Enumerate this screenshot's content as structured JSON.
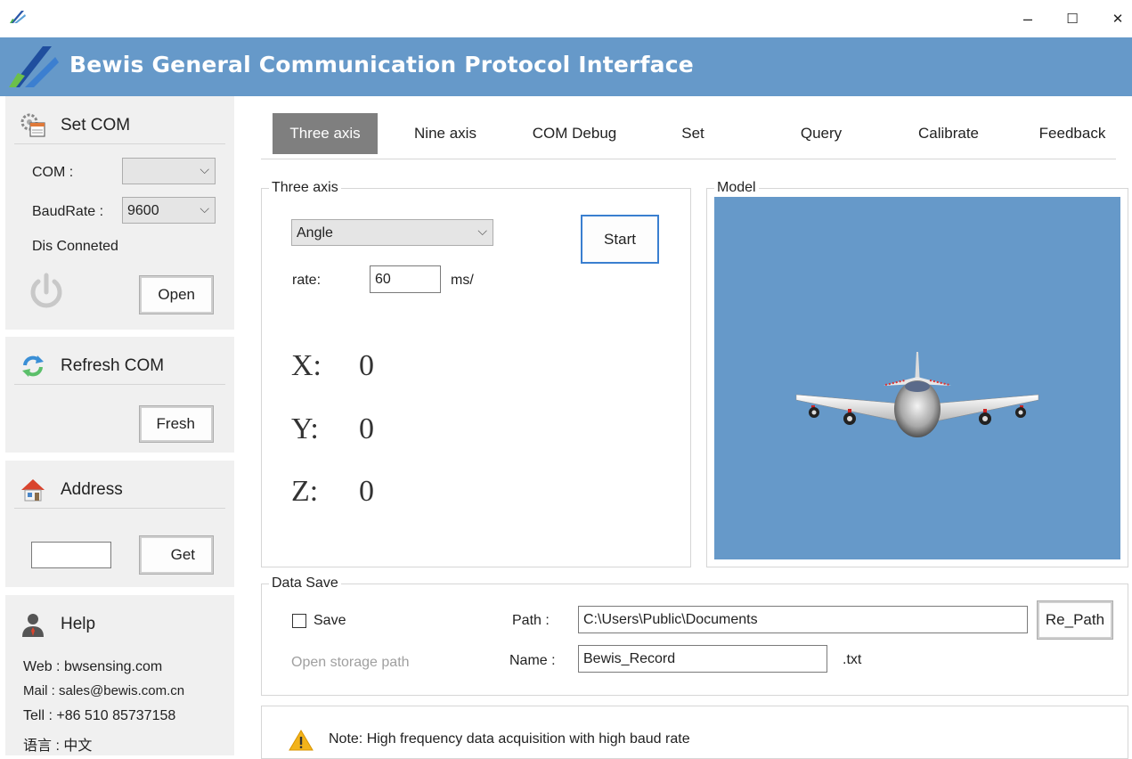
{
  "window": {
    "minimize_glyph": "–",
    "maximize_glyph": "☐",
    "close_glyph": "✕"
  },
  "header": {
    "title": "Bewis General Communication Protocol Interface",
    "color": "#6699c9"
  },
  "sidebar": {
    "set_com": {
      "title": "Set COM",
      "com_label": "COM :",
      "com_value": "",
      "baud_label": "BaudRate :",
      "baud_value": "9600",
      "status": "Dis Conneted",
      "open_button": "Open"
    },
    "refresh_com": {
      "title": "Refresh COM",
      "fresh_button": "Fresh"
    },
    "address": {
      "title": "Address",
      "address_value": "",
      "get_button": "Get"
    },
    "help": {
      "title": "Help",
      "web": "Web : bwsensing.com",
      "mail": "Mail : sales@bewis.com.cn",
      "tel": "Tell :  +86 510 85737158",
      "language": "语言 :  中文"
    }
  },
  "tabs": [
    {
      "label": "Three axis",
      "active": true
    },
    {
      "label": "Nine axis",
      "active": false
    },
    {
      "label": "COM Debug",
      "active": false
    },
    {
      "label": "Set",
      "active": false
    },
    {
      "label": "Query",
      "active": false
    },
    {
      "label": "Calibrate",
      "active": false
    },
    {
      "label": "Feedback",
      "active": false
    }
  ],
  "three_axis": {
    "group_title": "Three axis",
    "mode_value": "Angle",
    "start_button": "Start",
    "rate_label": "rate:",
    "rate_value": "60",
    "rate_unit": "ms/",
    "x_label": "X:",
    "x_value": "0",
    "y_label": "Y:",
    "y_value": "0",
    "z_label": "Z:",
    "z_value": "0"
  },
  "model": {
    "group_title": "Model"
  },
  "data_save": {
    "group_title": "Data Save",
    "save_label": "Save",
    "save_checked": false,
    "open_storage_link": "Open storage path",
    "path_label": "Path :",
    "path_value": "C:\\Users\\Public\\Documents",
    "repath_button": "Re_Path",
    "name_label": "Name :",
    "name_value": "Bewis_Record",
    "extension": ".txt"
  },
  "note": {
    "text": "Note: High frequency data acquisition with high baud rate"
  },
  "icons": {
    "app_logo": "bewis-logo-icon",
    "settings": "gear-calendar-icon",
    "power": "power-icon",
    "refresh": "refresh-icon",
    "home": "house-icon",
    "user": "user-icon",
    "warning": "warning-icon",
    "airplane": "airplane-model-icon"
  }
}
